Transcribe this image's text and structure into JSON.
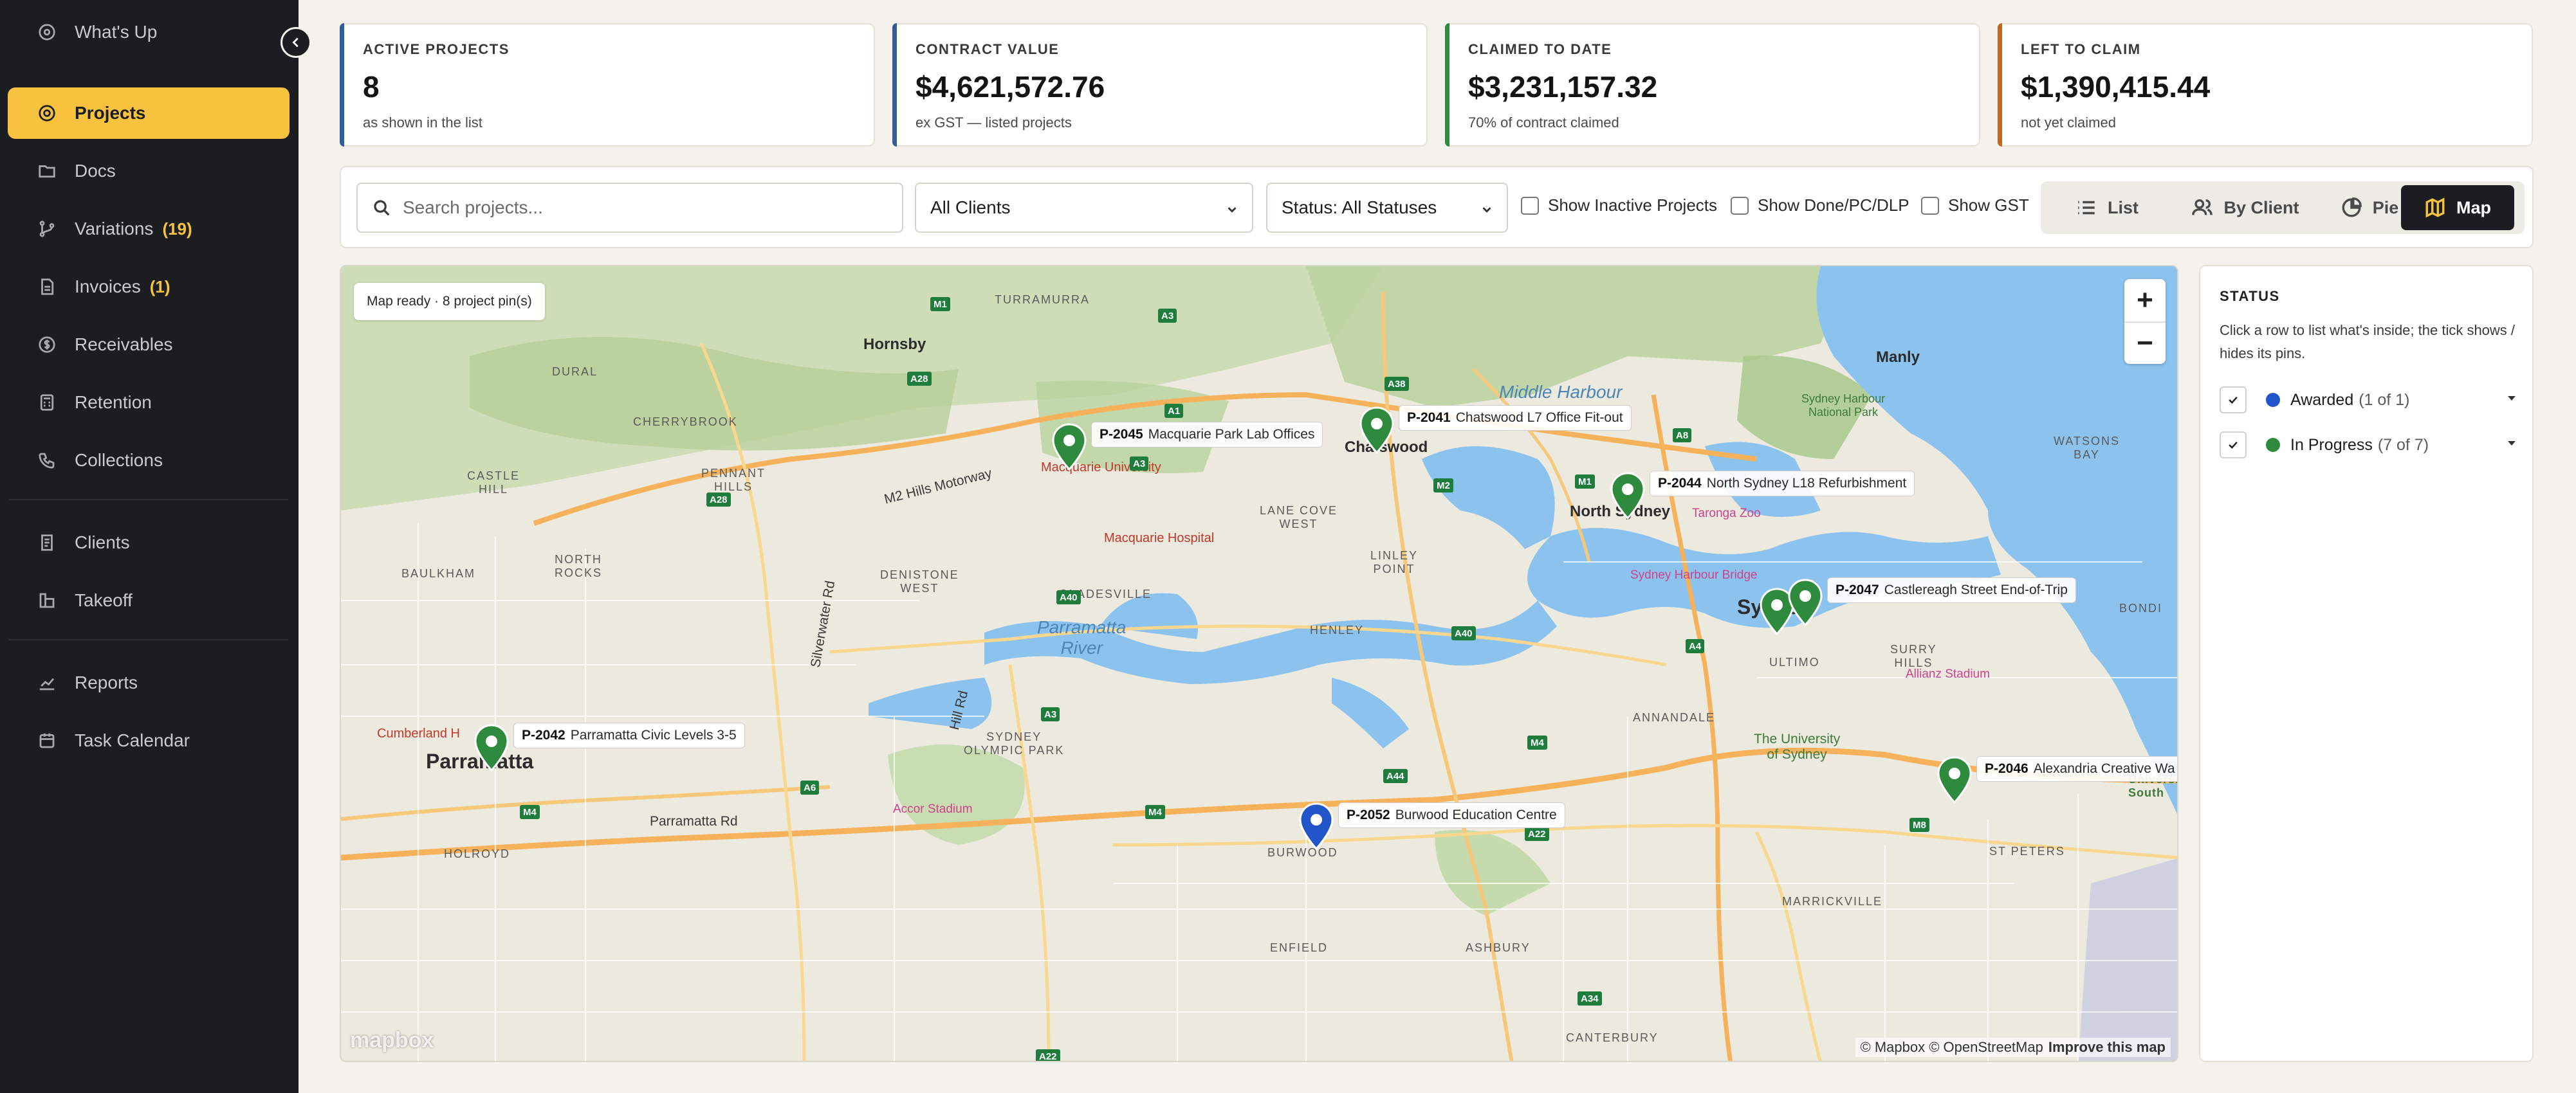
{
  "sidebar": {
    "items": [
      {
        "label": "What's Up",
        "icon": "target-icon"
      },
      {
        "label": "Projects",
        "icon": "location-icon",
        "active": true
      },
      {
        "label": "Docs",
        "icon": "folder-icon"
      },
      {
        "label": "Variations",
        "icon": "branch-icon",
        "badge": "(19)"
      },
      {
        "label": "Invoices",
        "icon": "file-icon",
        "badge": "(1)"
      },
      {
        "label": "Receivables",
        "icon": "coin-icon"
      },
      {
        "label": "Retention",
        "icon": "calculator-icon"
      },
      {
        "label": "Collections",
        "icon": "phone-icon"
      },
      {
        "label": "Clients",
        "icon": "document-icon"
      },
      {
        "label": "Takeoff",
        "icon": "ruler-icon"
      },
      {
        "label": "Reports",
        "icon": "chart-icon"
      },
      {
        "label": "Task Calendar",
        "icon": "calendar-icon"
      }
    ]
  },
  "stats": [
    {
      "label": "ACTIVE PROJECTS",
      "value": "8",
      "sub": "as shown in the list",
      "accent": "#2f5d9e"
    },
    {
      "label": "CONTRACT VALUE",
      "value": "$4,621,572.76",
      "sub": "ex GST — listed projects",
      "accent": "#2f5d9e"
    },
    {
      "label": "CLAIMED TO DATE",
      "value": "$3,231,157.32",
      "sub": "70% of contract claimed",
      "accent": "#2e8b3e"
    },
    {
      "label": "LEFT TO CLAIM",
      "value": "$1,390,415.44",
      "sub": "not yet claimed",
      "accent": "#c8641e"
    }
  ],
  "filters": {
    "search_placeholder": "Search projects...",
    "client_select": "All Clients",
    "status_select": "Status: All Statuses",
    "checks": [
      "Show Inactive Projects",
      "Show Done/PC/DLP",
      "Show GST"
    ],
    "views": [
      {
        "label": "List",
        "icon": "list-icon"
      },
      {
        "label": "By Client",
        "icon": "users-icon"
      },
      {
        "label": "Pie",
        "icon": "pie-icon"
      },
      {
        "label": "Map",
        "icon": "map-icon",
        "active": true
      }
    ]
  },
  "map": {
    "status": "Map ready · 8 project pin(s)",
    "zoom_in": "+",
    "zoom_out": "−",
    "logo": "mapbox",
    "attribution": "© Mapbox © OpenStreetMap",
    "improve": "Improve this map",
    "pins": [
      {
        "id": "P-2045",
        "name": "Macquarie Park Lab Offices",
        "color": "#2e8b3e"
      },
      {
        "id": "P-2041",
        "name": "Chatswood L7 Office Fit-out",
        "color": "#2e8b3e"
      },
      {
        "id": "P-2044",
        "name": "North Sydney L18 Refurbishment",
        "color": "#2e8b3e"
      },
      {
        "id": "P-2047",
        "name": "Castlereagh Street End-of-Trip",
        "color": "#2e8b3e"
      },
      {
        "id": "P-2042",
        "name": "Parramatta Civic Levels 3-5",
        "color": "#2e8b3e"
      },
      {
        "id": "P-2052",
        "name": "Burwood Education Centre",
        "color": "#2155c9"
      },
      {
        "id": "P-2046",
        "name": "Alexandria Creative Wa",
        "color": "#2e8b3e"
      },
      {
        "id": "",
        "name": "",
        "color": "#2e8b3e"
      }
    ],
    "places": {
      "hornsby": "Hornsby",
      "manly": "Manly",
      "chatswood": "Chatswood",
      "north_sydney": "North Sydney",
      "sydney": "Sydney",
      "parramatta": "Parramatta",
      "burwood": "BURWOOD",
      "mq_uni": "Macquarie University",
      "mq_hosp": "Macquarie Hospital",
      "cumberland": "Cumberland H",
      "gladesville": "GLADESVILLE",
      "lane_cove": "LANE COVE\nWEST",
      "denistone": "DENISTONE\nWEST",
      "henley": "HENLEY",
      "linley": "LINLEY\nPOINT",
      "north_rocks": "NORTH\nROCKS",
      "castle_hill": "CASTLE\nHILL",
      "pennant": "PENNANT\nHILLS",
      "cherrybrook": "CHERRYBROOK",
      "dural": "DURAL",
      "baulkham": "BAULKHAM",
      "holroyd": "HOLROYD",
      "enfield": "ENFIELD",
      "ashbury": "ASHBURY",
      "canterbury": "CANTERBURY",
      "marrickville": "MARRICKVILLE",
      "st_peters": "ST PETERS",
      "annandale": "ANNANDALE",
      "ultimo": "ULTIMO",
      "surry_hills": "SURRY\nHILLS",
      "bondi": "BONDI",
      "watsons_bay": "WATSONS\nBAY",
      "turramurra": "TURRAMURRA",
      "sydney_olympic": "SYDNEY\nOLYMPIC PARK",
      "uni_sydney": "The University\nof Sydney",
      "accor": "Accor Stadium",
      "allianz": "Allianz Stadium",
      "harbour_bridge": "Sydney Harbour Bridge",
      "taronga": "Taronga Zoo",
      "middle_harbour": "Middle Harbour",
      "parramatta_river": "Parramatta\nRiver",
      "harbour_np": "Sydney Harbour\nNational Park",
      "silverwater": "Silverwater Rd",
      "hill_rd": "Hill Rd",
      "m2": "M2 Hills Motorway",
      "parramatta_rd": "Parramatta Rd",
      "univ_south": "Universi\nSouth"
    }
  },
  "status_panel": {
    "title": "STATUS",
    "help": "Click a row to list what's inside; the tick shows / hides its pins.",
    "rows": [
      {
        "label": "Awarded",
        "count": "(1 of 1)",
        "color": "#2155c9"
      },
      {
        "label": "In Progress",
        "count": "(7 of 7)",
        "color": "#2e8b3e"
      }
    ]
  }
}
